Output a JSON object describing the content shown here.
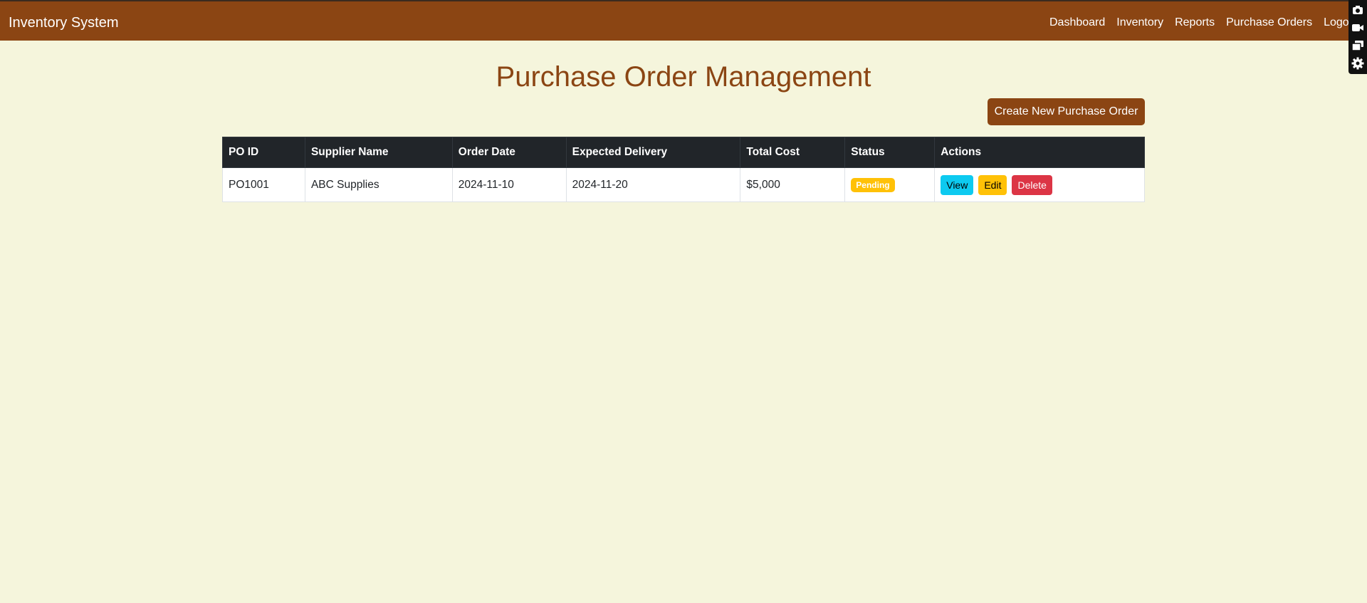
{
  "nav": {
    "brand": "Inventory System",
    "links": [
      "Dashboard",
      "Inventory",
      "Reports",
      "Purchase Orders",
      "Logout"
    ]
  },
  "page": {
    "title": "Purchase Order Management",
    "create_button": "Create New Purchase Order"
  },
  "table": {
    "headers": [
      "PO ID",
      "Supplier Name",
      "Order Date",
      "Expected Delivery",
      "Total Cost",
      "Status",
      "Actions"
    ],
    "rows": [
      {
        "po_id": "PO1001",
        "supplier": "ABC Supplies",
        "order_date": "2024-11-10",
        "expected_delivery": "2024-11-20",
        "total_cost": "$5,000",
        "status": "Pending"
      }
    ],
    "actions": {
      "view": "View",
      "edit": "Edit",
      "delete": "Delete"
    }
  },
  "tools": [
    "camera-icon",
    "video-icon",
    "windows-icon",
    "gear-icon"
  ],
  "colors": {
    "brand": "#8b4513",
    "background": "#f5f5dc",
    "header_dark": "#212529",
    "pending": "#ffc107",
    "view": "#0dcaf0",
    "delete": "#dc3545"
  }
}
